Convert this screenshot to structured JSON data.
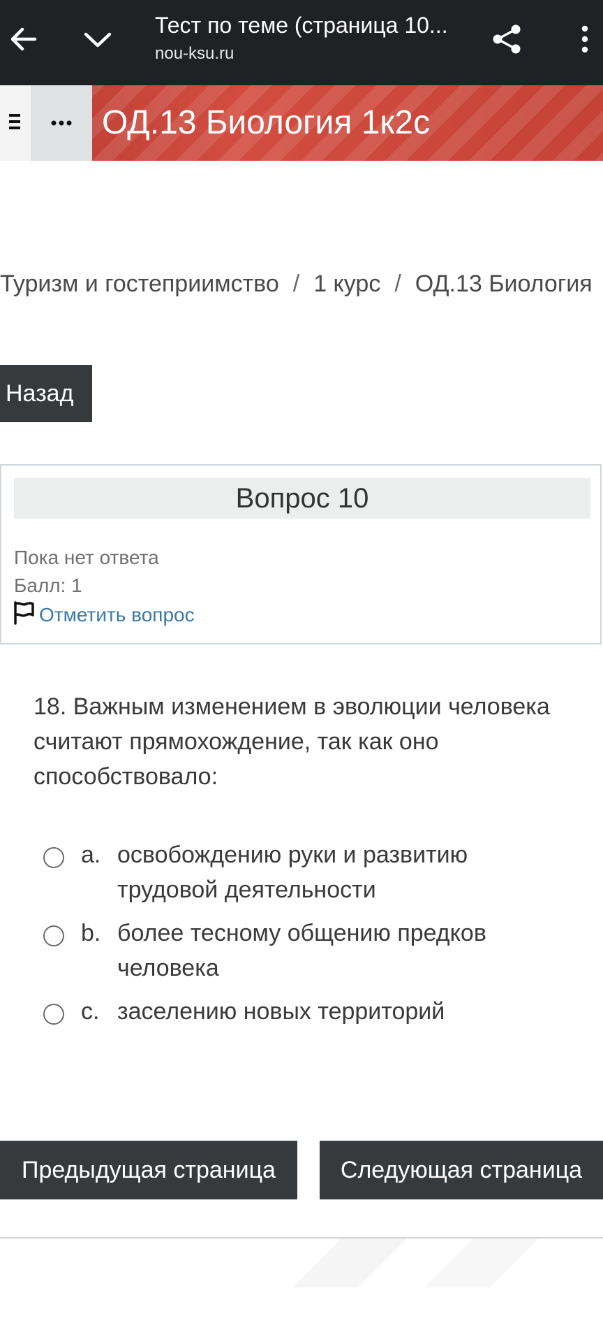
{
  "browser": {
    "title": "Тест по теме (страница 10...",
    "url": "nou-ksu.ru"
  },
  "course": {
    "title": "ОД.13 Биология 1к2с"
  },
  "breadcrumb": {
    "items": [
      "Туризм и гостеприимство",
      "1 курс",
      "ОД.13 Биология"
    ],
    "separator": "/"
  },
  "back_button": "Назад",
  "question_info": {
    "heading": "Вопрос 10",
    "state": "Пока нет ответа",
    "grade": "Балл: 1",
    "flag_label": "Отметить вопрос"
  },
  "question": {
    "text": "18. Важным изменением в эволюции человека считают прямохождение, так как оно способствовало:",
    "answers": [
      {
        "letter": "a.",
        "text": "освобождению руки и развитию трудовой деятельности"
      },
      {
        "letter": "b.",
        "text": "более тесному общению предков человека"
      },
      {
        "letter": "c.",
        "text": "заселению новых территорий"
      }
    ]
  },
  "navigation": {
    "prev": "Предыдущая страница",
    "next": "Следующая страница"
  },
  "colors": {
    "topbar": "#202124",
    "banner": "#c0453a",
    "button": "#373a3c",
    "link": "#3a79a8"
  }
}
